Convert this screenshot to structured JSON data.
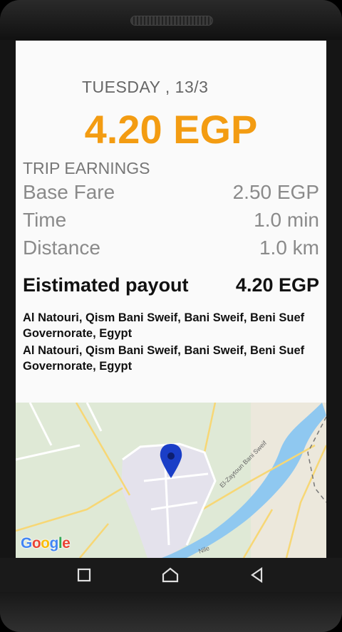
{
  "trip": {
    "date": "TUESDAY , 13/3",
    "total": "4.20 EGP",
    "section_title": "TRIP EARNINGS",
    "rows": [
      {
        "label": "Base Fare",
        "value": "2.50 EGP"
      },
      {
        "label": "Time",
        "value": "1.0 min"
      },
      {
        "label": "Distance",
        "value": "1.0 km"
      }
    ],
    "payout": {
      "label": "Eistimated payout",
      "value": "4.20 EGP"
    },
    "pickup_address": "Al Natouri, Qism Bani Sweif, Bani Sweif, Beni Suef Governorate, Egypt",
    "dropoff_address": "Al Natouri, Qism Bani Sweif, Bani Sweif, Beni Suef Governorate, Egypt"
  },
  "map": {
    "road_label": "El-Zaytoun Bani Sweif",
    "river_label": "Nile",
    "google_logo": {
      "G": "G",
      "o1": "o",
      "o2": "o",
      "g": "g",
      "l": "l",
      "e": "e"
    },
    "marker_color": "#1a3ec7",
    "river_color": "#8fc8f0"
  },
  "navbar": {
    "icons": [
      "square-icon",
      "home-icon",
      "back-icon"
    ]
  },
  "colors": {
    "accent": "#f39c12"
  }
}
